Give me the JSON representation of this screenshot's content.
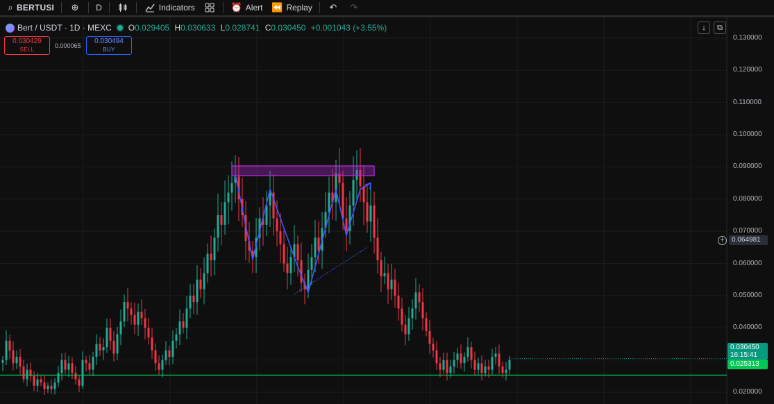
{
  "toolbar": {
    "symbol": "BERTUSI",
    "interval": "D",
    "indicators_label": "Indicators",
    "alert_label": "Alert",
    "replay_label": "Replay"
  },
  "legend": {
    "title": "Bert / USDT · 1D · MEXC",
    "open_label": "O",
    "open": "0.029405",
    "high_label": "H",
    "high": "0.030633",
    "low_label": "L",
    "low": "0.028741",
    "close_label": "C",
    "close": "0.030450",
    "change": "+0.001043 (+3.55%)"
  },
  "trade": {
    "sell_price": "0.030429",
    "sell_label": "SELL",
    "spread": "0.000065",
    "buy_price": "0.030494",
    "buy_label": "BUY"
  },
  "scale": {
    "crosshair_price": "0.064981",
    "last_price": "0.030450",
    "countdown": "16:15:41",
    "line_price": "0.025313"
  },
  "colors": {
    "up": "#22ab94",
    "down": "#f23645",
    "pattern": "#3f56ff",
    "zone": "#b02bd6",
    "hline": "#00c853"
  },
  "chart_data": {
    "type": "candlestick",
    "title": "Bert / USDT · 1D · MEXC",
    "ylim": [
      0.0185,
      0.1345
    ],
    "y_ticks": [
      "0.130000",
      "0.120000",
      "0.110000",
      "0.100000",
      "0.090000",
      "0.080000",
      "0.070000",
      "0.060000",
      "0.050000",
      "0.040000",
      "0.030000",
      "0.020000"
    ],
    "grid": true,
    "horizontal_line": 0.025313,
    "resistance_zone": [
      0.0873,
      0.0903
    ],
    "pattern_points": [
      [
        67,
        0.0877
      ],
      [
        72,
        0.0612
      ],
      [
        77,
        0.083
      ],
      [
        85,
        0.059
      ],
      [
        88,
        0.051
      ],
      [
        96,
        0.083
      ],
      [
        99,
        0.0687
      ],
      [
        103,
        0.083
      ],
      [
        106,
        0.085
      ]
    ],
    "trend_line": [
      [
        84,
        0.0505
      ],
      [
        105,
        0.065
      ]
    ],
    "closes": [
      0.03,
      0.036,
      0.033,
      0.029,
      0.031,
      0.028,
      0.024,
      0.027,
      0.025,
      0.022,
      0.024,
      0.023,
      0.021,
      0.022,
      0.021,
      0.023,
      0.026,
      0.03,
      0.027,
      0.029,
      0.026,
      0.024,
      0.022,
      0.03,
      0.029,
      0.027,
      0.031,
      0.035,
      0.033,
      0.034,
      0.04,
      0.036,
      0.032,
      0.038,
      0.042,
      0.048,
      0.046,
      0.044,
      0.041,
      0.045,
      0.043,
      0.04,
      0.037,
      0.033,
      0.029,
      0.027,
      0.03,
      0.033,
      0.031,
      0.036,
      0.038,
      0.042,
      0.04,
      0.046,
      0.05,
      0.048,
      0.055,
      0.052,
      0.057,
      0.063,
      0.061,
      0.068,
      0.075,
      0.072,
      0.079,
      0.082,
      0.085,
      0.087,
      0.08,
      0.075,
      0.067,
      0.064,
      0.062,
      0.068,
      0.074,
      0.072,
      0.078,
      0.082,
      0.074,
      0.07,
      0.066,
      0.06,
      0.057,
      0.062,
      0.066,
      0.061,
      0.054,
      0.052,
      0.058,
      0.062,
      0.068,
      0.064,
      0.071,
      0.076,
      0.082,
      0.079,
      0.088,
      0.085,
      0.074,
      0.07,
      0.078,
      0.086,
      0.089,
      0.084,
      0.079,
      0.073,
      0.078,
      0.068,
      0.061,
      0.056,
      0.057,
      0.052,
      0.055,
      0.05,
      0.046,
      0.041,
      0.038,
      0.043,
      0.046,
      0.051,
      0.048,
      0.043,
      0.039,
      0.035,
      0.033,
      0.029,
      0.027,
      0.03,
      0.026,
      0.028,
      0.03,
      0.032,
      0.029,
      0.031,
      0.034,
      0.03,
      0.027,
      0.029,
      0.026,
      0.028,
      0.027,
      0.031,
      0.032,
      0.028,
      0.026,
      0.027,
      0.03
    ]
  }
}
